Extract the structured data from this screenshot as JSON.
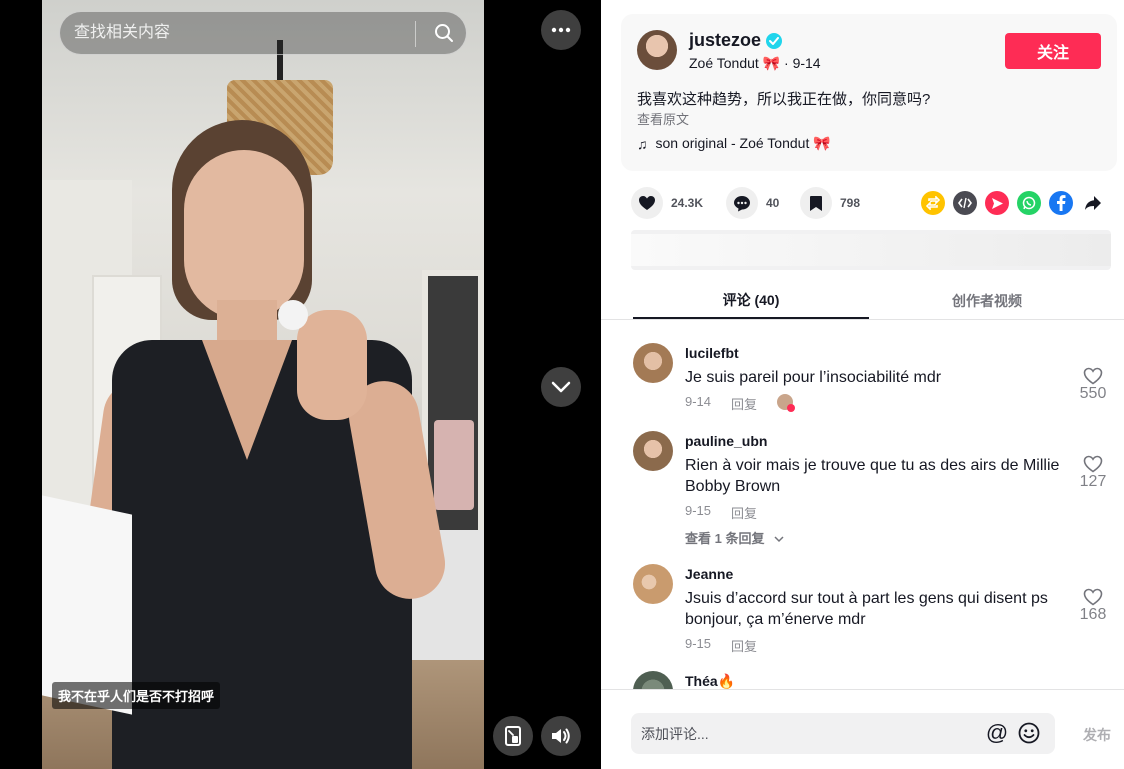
{
  "search": {
    "placeholder": "查找相关内容"
  },
  "video": {
    "caption": "我不在乎人们是否不打招呼"
  },
  "author": {
    "username": "justezoe",
    "display_name": "Zoé Tondut 🎀",
    "date": "· 9-14",
    "follow_label": "关注"
  },
  "post": {
    "description": "我喜欢这种趋势，所以我正在做，你同意吗?",
    "see_original": "查看原文",
    "music": "son original - Zoé Tondut 🎀"
  },
  "actions": {
    "likes": "24.3K",
    "comments": "40",
    "saves": "798"
  },
  "share_colors": {
    "repost": "#ffc300",
    "embed": "#4a4a52",
    "send": "#fe2c55",
    "whatsapp": "#25d366",
    "facebook": "#1877f2"
  },
  "tabs": [
    {
      "label": "评论 (40)"
    },
    {
      "label": "创作者视频"
    }
  ],
  "comments": [
    {
      "user": "lucilefbt",
      "text": "Je suis pareil pour l’insociabilité mdr",
      "date": "9-14",
      "reply": "回复",
      "likes": "550"
    },
    {
      "user": "pauline_ubn",
      "text": "Rien à voir mais je trouve que tu as des airs de Millie Bobby Brown",
      "date": "9-15",
      "reply": "回复",
      "likes": "127",
      "view_replies": "查看 1 条回复"
    },
    {
      "user": "Jeanne",
      "text": "Jsuis d’accord sur tout à part les gens qui disent ps bonjour, ça m’énerve mdr",
      "date": "9-15",
      "reply": "回复",
      "likes": "168"
    },
    {
      "user": "Théa🔥"
    }
  ],
  "comment_input": {
    "placeholder": "添加评论...",
    "post_label": "发布"
  }
}
